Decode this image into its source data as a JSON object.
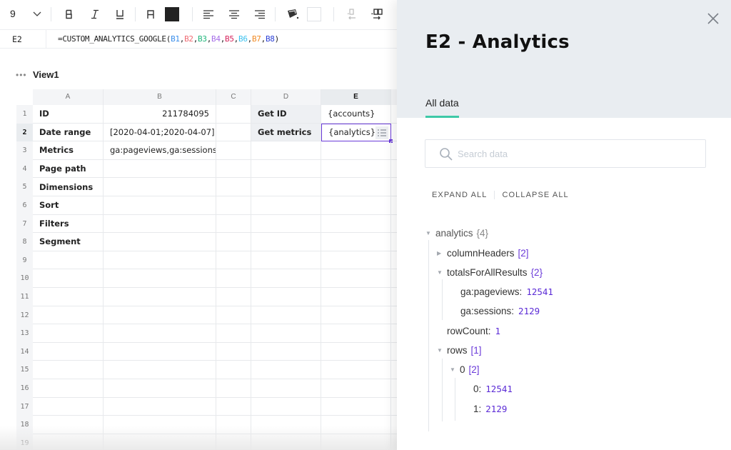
{
  "toolbar": {
    "font_size": "9",
    "buttons": [
      "font-size-dropdown",
      "bold",
      "italic",
      "underline",
      "text-color",
      "align-left",
      "align-center",
      "align-right",
      "fill-color",
      "decrease-decimal",
      "increase-decimal"
    ],
    "text_color": "#222222",
    "fill_color": "#ffffff"
  },
  "formula_bar": {
    "cell_ref": "E2",
    "formula_prefix": "=CUSTOM_ANALYTICS_GOOGLE(",
    "args": [
      {
        "ref": "B1",
        "color": "#3b8eea"
      },
      {
        "ref": "B2",
        "color": "#ef6b73"
      },
      {
        "ref": "B3",
        "color": "#1fb57a"
      },
      {
        "ref": "B4",
        "color": "#a66ee8"
      },
      {
        "ref": "B5",
        "color": "#d6245c"
      },
      {
        "ref": "B6",
        "color": "#3cc2ef"
      },
      {
        "ref": "B7",
        "color": "#f08a24"
      },
      {
        "ref": "B8",
        "color": "#2b3fd6"
      }
    ],
    "formula_suffix": ")"
  },
  "view": {
    "name": "View1",
    "menu_icon": "more-dots-icon"
  },
  "grid": {
    "columns": [
      "A",
      "B",
      "C",
      "D",
      "E"
    ],
    "active_column": "E",
    "active_row": 2,
    "row_numbers": [
      1,
      2,
      3,
      4,
      5,
      6,
      7,
      8,
      9,
      10,
      11,
      12,
      13,
      14,
      15,
      16,
      17,
      18,
      19
    ],
    "labels": [
      "ID",
      "Date range",
      "Metrics",
      "Page path",
      "Dimensions",
      "Sort",
      "Filters",
      "Segment"
    ],
    "values": [
      "211784095",
      "[2020-04-01;2020-04-07]",
      "ga:pageviews,ga:sessions"
    ],
    "d_cells": [
      "Get ID",
      "Get metrics"
    ],
    "e_cells": [
      "{accounts}",
      "{analytics}"
    ],
    "selection_color": "#6b3bd9"
  },
  "panel": {
    "title": "E2 - Analytics",
    "tab": "All data",
    "tab_accent": "#3ec9a7",
    "search_placeholder": "Search data",
    "expand_all": "EXPAND ALL",
    "collapse_all": "COLLAPSE ALL",
    "tree": {
      "root": {
        "key": "analytics",
        "count": "{4}"
      },
      "columnHeaders": {
        "key": "columnHeaders",
        "count": "[2]",
        "expanded": false
      },
      "totals": {
        "key": "totalsForAllResults",
        "count": "{2}",
        "expanded": true
      },
      "pageviews": {
        "key": "ga:pageviews:",
        "value": "12541"
      },
      "sessions": {
        "key": "ga:sessions:",
        "value": "2129"
      },
      "rowCount": {
        "key": "rowCount:",
        "value": "1"
      },
      "rows": {
        "key": "rows",
        "count": "[1]",
        "expanded": true
      },
      "row0": {
        "key": "0",
        "count": "[2]",
        "expanded": true
      },
      "row0_0": {
        "key": "0:",
        "value": "12541"
      },
      "row0_1": {
        "key": "1:",
        "value": "2129"
      }
    }
  }
}
